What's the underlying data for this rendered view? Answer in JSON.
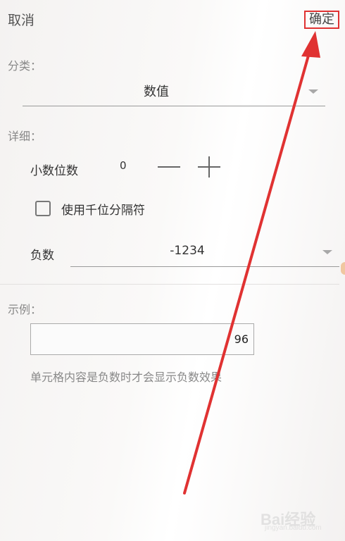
{
  "topbar": {
    "cancel_label": "取消",
    "ok_label": "确定"
  },
  "category": {
    "section_label": "分类：",
    "selected": "数值"
  },
  "details": {
    "section_label": "详细：",
    "decimal_label": "小数位数",
    "decimal_value": "0",
    "thousands_label": "使用千位分隔符",
    "thousands_checked": false,
    "negative_label": "负数",
    "negative_selected": "-1234"
  },
  "sample": {
    "section_label": "示例：",
    "value": "96",
    "hint": "单元格内容是负数时才会显示负数效果"
  },
  "watermark": {
    "text": "Bai经验",
    "sub": "jingyan.baidu.com"
  },
  "colors": {
    "annotation_red": "#e03232",
    "caret_gray": "#a8a8a8"
  }
}
